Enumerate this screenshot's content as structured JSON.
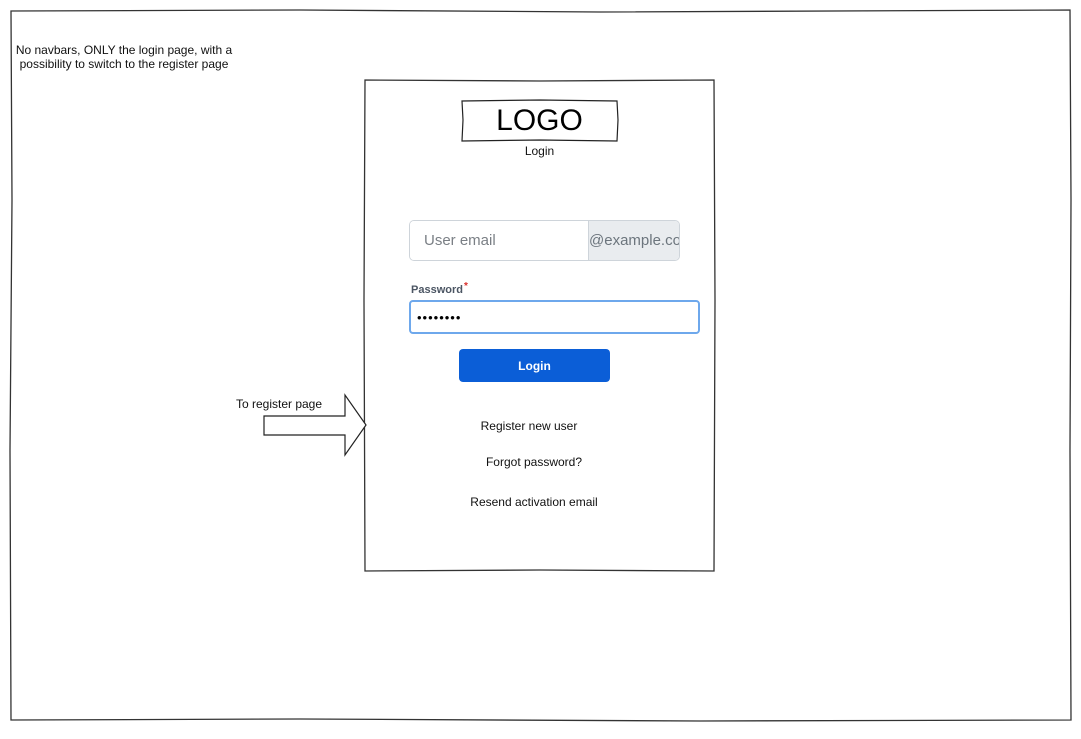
{
  "annotations": {
    "note": "No navbars, ONLY the login page, with a possibility to switch to the register page",
    "arrow_label": "To register page"
  },
  "login_card": {
    "logo_text": "LOGO",
    "subtitle": "Login",
    "email": {
      "placeholder": "User email",
      "addon": "@example.com"
    },
    "password": {
      "label": "Password",
      "required_mark": "*",
      "value": "••••••••"
    },
    "login_button": "Login",
    "links": {
      "register": "Register new user",
      "forgot": "Forgot password?",
      "resend": "Resend activation email"
    }
  }
}
